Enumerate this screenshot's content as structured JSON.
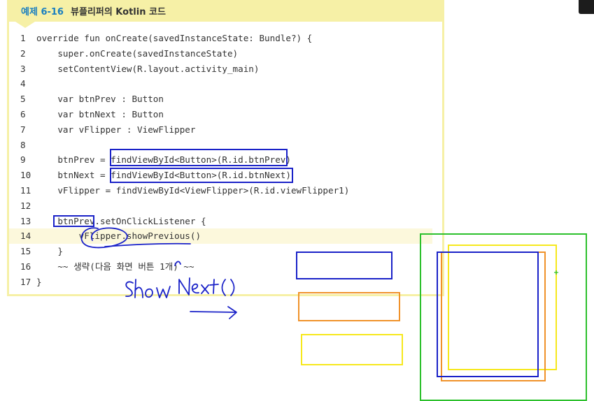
{
  "header": {
    "number": "예제 6-16",
    "title": "뷰플리퍼의 Kotlin 코드"
  },
  "code_lines": [
    {
      "num": "1",
      "text": "override fun onCreate(savedInstanceState: Bundle?) {"
    },
    {
      "num": "2",
      "text": "    super.onCreate(savedInstanceState)"
    },
    {
      "num": "3",
      "text": "    setContentView(R.layout.activity_main)"
    },
    {
      "num": "4",
      "text": ""
    },
    {
      "num": "5",
      "text": "    var btnPrev : Button"
    },
    {
      "num": "6",
      "text": "    var btnNext : Button"
    },
    {
      "num": "7",
      "text": "    var vFlipper : ViewFlipper"
    },
    {
      "num": "8",
      "text": ""
    },
    {
      "num": "9",
      "text": "    btnPrev = findViewById<Button>(R.id.btnPrev)"
    },
    {
      "num": "10",
      "text": "    btnNext = findViewById<Button>(R.id.btnNext)"
    },
    {
      "num": "11",
      "text": "    vFlipper = findViewById<ViewFlipper>(R.id.viewFlipper1)"
    },
    {
      "num": "12",
      "text": ""
    },
    {
      "num": "13",
      "text": "    btnPrev.setOnClickListener {"
    },
    {
      "num": "14",
      "text": "        vFlipper.showPrevious()"
    },
    {
      "num": "15",
      "text": "    }"
    },
    {
      "num": "16",
      "text": "    ~~ 생략(다음 화면 버튼 1개) ~~"
    },
    {
      "num": "17",
      "text": "}"
    }
  ],
  "highlighted_line": "14",
  "handwriting": {
    "text": "ShowNext()"
  },
  "colors": {
    "header_bg": "#f6f0a6",
    "header_number": "#1a7fc0",
    "line_highlight": "#fcf8dc",
    "annot_blue": "#1a22c8",
    "annot_orange": "#f0922a",
    "annot_yellow": "#f6e81c",
    "annot_green": "#2cc02c"
  }
}
